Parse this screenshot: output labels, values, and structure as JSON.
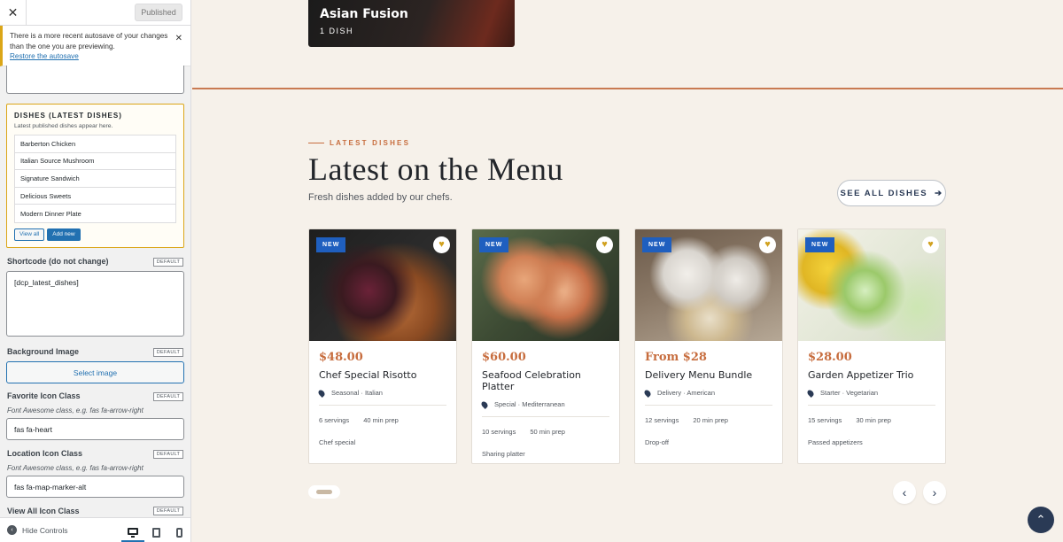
{
  "sidebar": {
    "close_icon": "close-icon",
    "publish_label": "Published",
    "notice": {
      "text": "There is a more recent autosave of your changes than the one you are previewing.",
      "restore_link": "Restore the autosave"
    },
    "dishes_section": {
      "title": "DISHES (LATEST DISHES)",
      "description": "Latest published dishes appear here.",
      "items": [
        "Barberton Chicken",
        "Italian Source Mushroom",
        "Signature Sandwich",
        "Delicious Sweets",
        "Modern Dinner Plate"
      ],
      "view_all_label": "View all",
      "add_new_label": "Add new"
    },
    "fields": {
      "shortcode": {
        "label": "Shortcode (do not change)",
        "badge": "DEFAULT",
        "value": "[dcp_latest_dishes]"
      },
      "background_image": {
        "label": "Background Image",
        "badge": "DEFAULT",
        "button": "Select image"
      },
      "favorite_icon": {
        "label": "Favorite Icon Class",
        "badge": "DEFAULT",
        "hint": "Font Awesome class, e.g. fas fa-arrow-right",
        "value": "fas fa-heart"
      },
      "location_icon": {
        "label": "Location Icon Class",
        "badge": "DEFAULT",
        "hint": "Font Awesome class, e.g. fas fa-arrow-right",
        "value": "fas fa-map-marker-alt"
      },
      "view_all_icon": {
        "label": "View All Icon Class",
        "badge": "DEFAULT"
      }
    },
    "footer": {
      "hide_controls": "Hide Controls"
    }
  },
  "preview": {
    "hero": {
      "title": "Asian Fusion",
      "count": "1 DISH"
    },
    "section": {
      "eyebrow": "LATEST DISHES",
      "heading": "Latest on the Menu",
      "subheading": "Fresh dishes added by our chefs.",
      "see_all": "SEE ALL DISHES",
      "see_all_icon": "arrow-right-icon"
    },
    "badge_new": "NEW",
    "cards": [
      {
        "price": "$48.00",
        "name": "Chef Special Risotto",
        "meta": "Seasonal · Italian",
        "servings": "6 servings",
        "prep": "40 min prep",
        "tag": "Chef special"
      },
      {
        "price": "$60.00",
        "name": "Seafood Celebration Platter",
        "meta": "Special · Mediterranean",
        "servings": "10 servings",
        "prep": "50 min prep",
        "tag": "Sharing platter"
      },
      {
        "price": "From $28",
        "name": "Delivery Menu Bundle",
        "meta": "Delivery · American",
        "servings": "12 servings",
        "prep": "20 min prep",
        "tag": "Drop-off"
      },
      {
        "price": "$28.00",
        "name": "Garden Appetizer Trio",
        "meta": "Starter · Vegetarian",
        "servings": "15 servings",
        "prep": "30 min prep",
        "tag": "Passed appetizers"
      }
    ],
    "colors": {
      "accent": "#c76d3e",
      "badge": "#1f5fbf",
      "heart": "#d1a11f",
      "navy": "#2a3a55"
    }
  }
}
